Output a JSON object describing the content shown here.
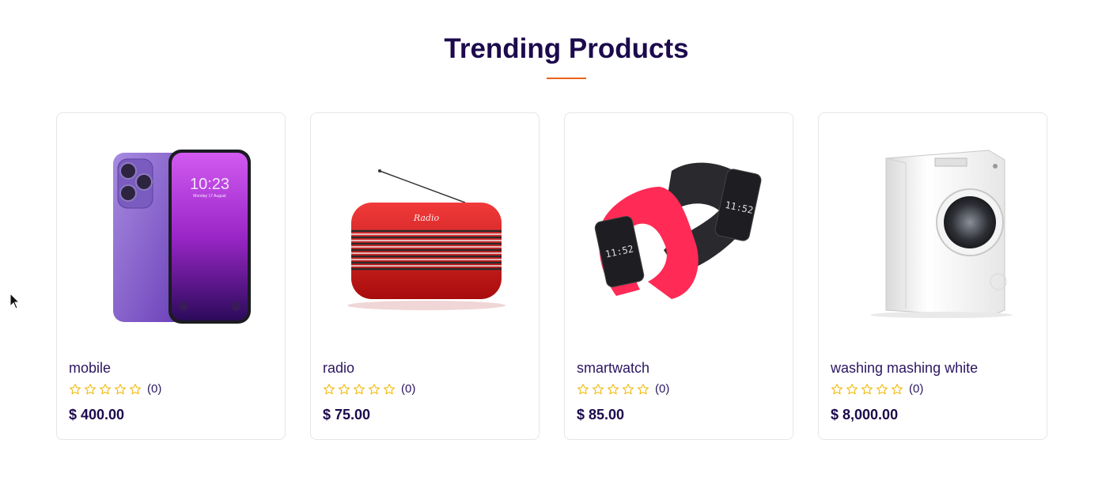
{
  "section": {
    "title": "Trending Products",
    "accent_color": "#e8631a",
    "title_color": "#1c0a4d"
  },
  "products": [
    {
      "name": "mobile",
      "image_icon": "smartphone-image",
      "rating_stars": 0,
      "rating_max": 5,
      "reviews": "(0)",
      "price": "$ 400.00"
    },
    {
      "name": "radio",
      "image_icon": "radio-image",
      "rating_stars": 0,
      "rating_max": 5,
      "reviews": "(0)",
      "price": "$ 75.00"
    },
    {
      "name": "smartwatch",
      "image_icon": "smartwatch-image",
      "rating_stars": 0,
      "rating_max": 5,
      "reviews": "(0)",
      "price": "$ 85.00"
    },
    {
      "name": "washing mashing white",
      "image_icon": "washing-machine-image",
      "rating_stars": 0,
      "rating_max": 5,
      "reviews": "(0)",
      "price": "$ 8,000.00"
    }
  ],
  "star_color": "#f2b705"
}
